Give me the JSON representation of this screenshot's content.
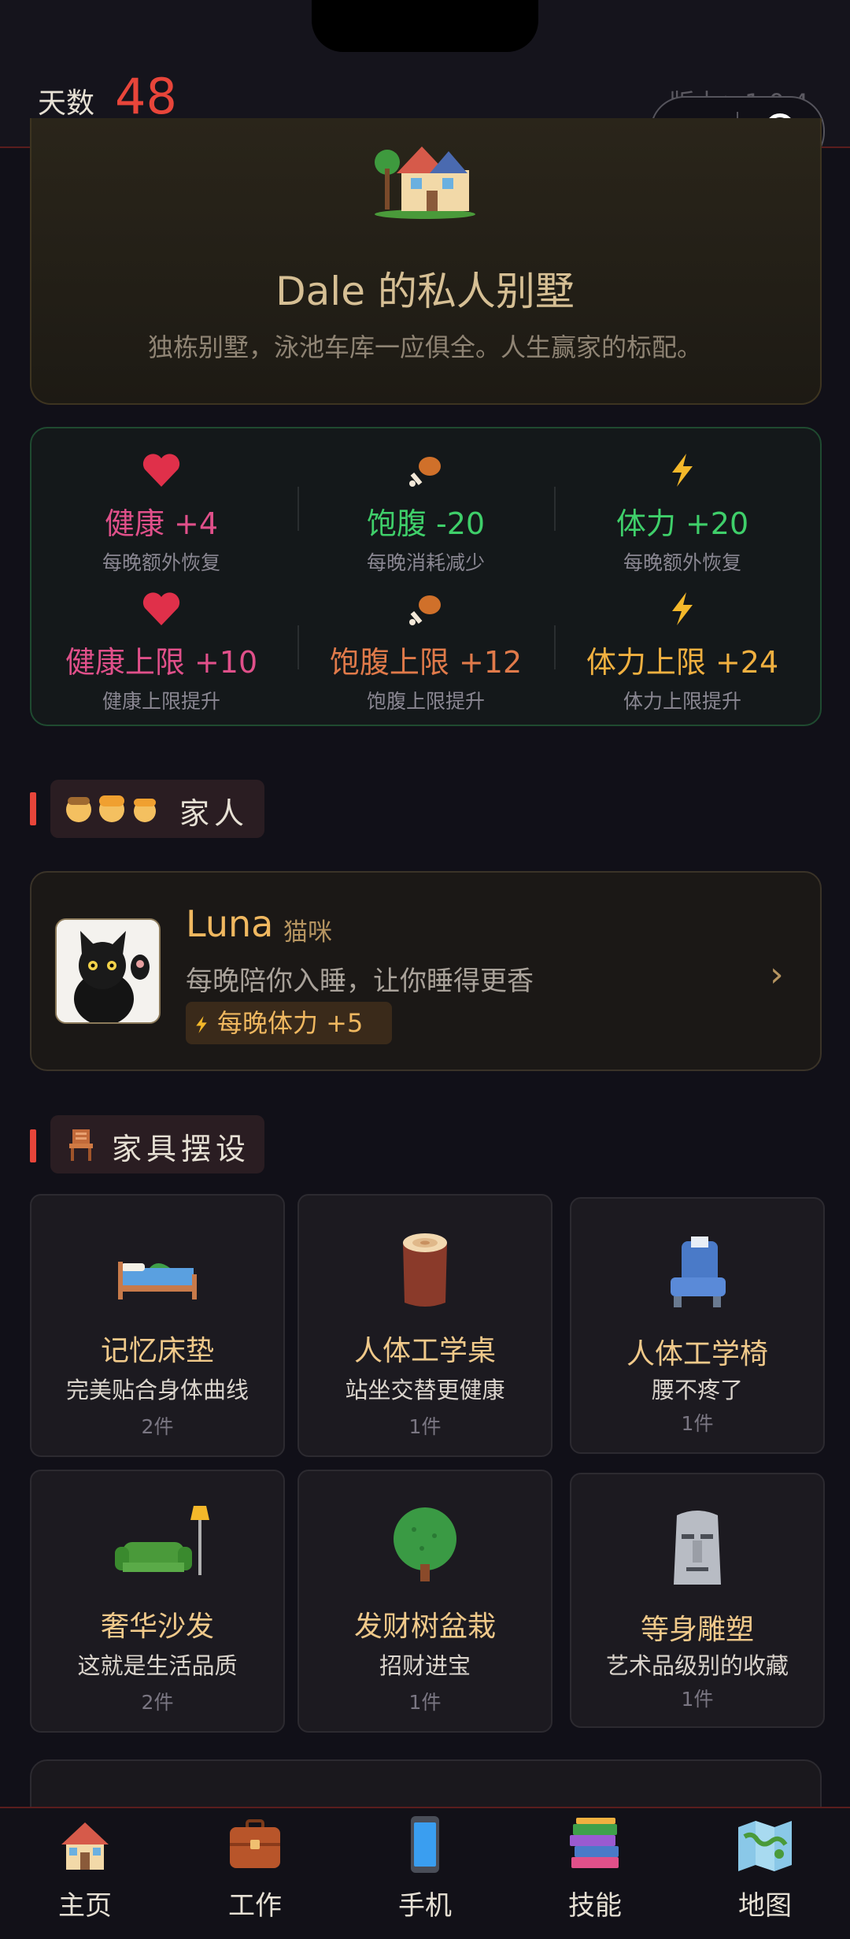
{
  "header": {
    "days_label": "天数",
    "days_value": "48",
    "version": "版本：1.0.4"
  },
  "villa": {
    "title": "Dale 的私人别墅",
    "description": "独栋别墅，泳池车库一应俱全。人生赢家的标配。",
    "icon": "house-icon"
  },
  "stats": [
    {
      "icon": "heart-icon",
      "value": "健康 +4",
      "sub": "每晚额外恢复",
      "color": "#e0508a"
    },
    {
      "icon": "drumstick-icon",
      "value": "饱腹 -20",
      "sub": "每晚消耗减少",
      "color": "#3fcf6a"
    },
    {
      "icon": "lightning-icon",
      "value": "体力 +20",
      "sub": "每晚额外恢复",
      "color": "#3fcf6a"
    },
    {
      "icon": "heart-icon",
      "value": "健康上限 +10",
      "sub": "健康上限提升",
      "color": "#e0508a"
    },
    {
      "icon": "drumstick-icon",
      "value": "饱腹上限 +12",
      "sub": "饱腹上限提升",
      "color": "#e07a4a"
    },
    {
      "icon": "lightning-icon",
      "value": "体力上限 +24",
      "sub": "体力上限提升",
      "color": "#f0b040"
    }
  ],
  "family_section": {
    "title": "家人",
    "icon": "family-icon"
  },
  "family": {
    "name": "Luna",
    "type": "猫咪",
    "description": "每晚陪你入睡，让你睡得更香",
    "buff": "每晚体力 +5"
  },
  "furniture_section": {
    "title": "家具摆设",
    "icon": "chair-icon"
  },
  "furniture": [
    {
      "name": "记忆床垫",
      "desc": "完美贴合身体曲线",
      "count": "2件",
      "icon": "bed-icon"
    },
    {
      "name": "人体工学桌",
      "desc": "站坐交替更健康",
      "count": "1件",
      "icon": "wood-log-icon"
    },
    {
      "name": "人体工学椅",
      "desc": "腰不疼了",
      "count": "1件",
      "icon": "seat-icon"
    },
    {
      "name": "奢华沙发",
      "desc": "这就是生活品质",
      "count": "2件",
      "icon": "sofa-lamp-icon"
    },
    {
      "name": "发财树盆栽",
      "desc": "招财进宝",
      "count": "1件",
      "icon": "tree-icon"
    },
    {
      "name": "等身雕塑",
      "desc": "艺术品级别的收藏",
      "count": "1件",
      "icon": "moai-icon"
    }
  ],
  "tabs": [
    {
      "label": "主页",
      "icon": "house-icon"
    },
    {
      "label": "工作",
      "icon": "briefcase-icon"
    },
    {
      "label": "手机",
      "icon": "phone-icon"
    },
    {
      "label": "技能",
      "icon": "books-icon"
    },
    {
      "label": "地图",
      "icon": "map-icon"
    }
  ],
  "colors": {
    "accent_red": "#e8453a",
    "gold": "#f0b860",
    "background": "#111018"
  }
}
